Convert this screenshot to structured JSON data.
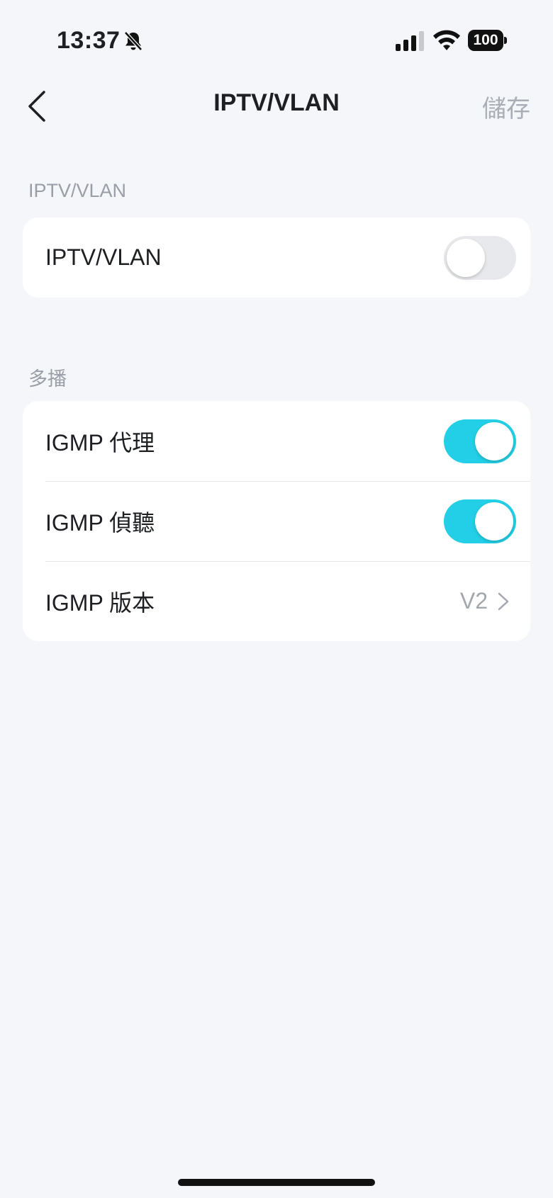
{
  "status_bar": {
    "time": "13:37",
    "battery": "100"
  },
  "nav": {
    "title": "IPTV/VLAN",
    "save_label": "儲存"
  },
  "section_iptv": {
    "header": "IPTV/VLAN",
    "rows": [
      {
        "label": "IPTV/VLAN",
        "toggle": "off"
      }
    ]
  },
  "section_multicast": {
    "header": "多播",
    "rows": [
      {
        "label": "IGMP 代理",
        "toggle": "on"
      },
      {
        "label": "IGMP 偵聽",
        "toggle": "on"
      },
      {
        "label": "IGMP 版本",
        "value": "V2"
      }
    ]
  },
  "colors": {
    "accent": "#22cfe6",
    "background": "#f4f6fa",
    "card": "#ffffff",
    "muted_text": "#9a9ea6"
  },
  "icons": [
    "bell-slash-icon",
    "cellular-signal-icon",
    "wifi-icon",
    "battery-icon",
    "chevron-left-icon",
    "chevron-right-icon"
  ]
}
